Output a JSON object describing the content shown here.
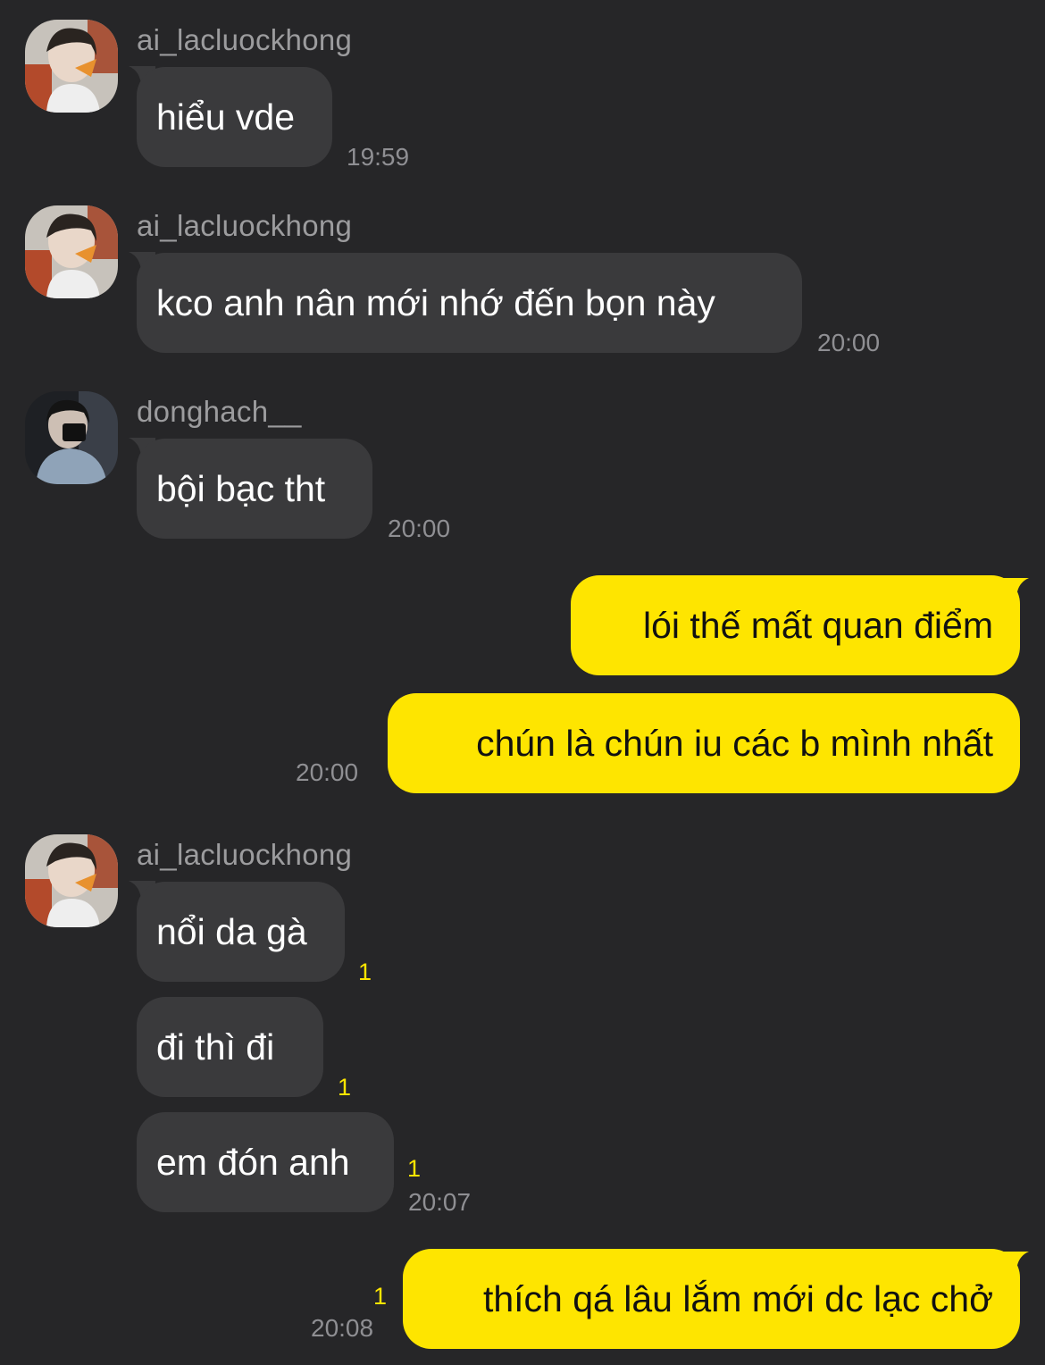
{
  "colors": {
    "background": "#262628",
    "incoming_bubble": "#3a3a3c",
    "outgoing_bubble": "#fee500",
    "unread": "#fee500",
    "meta_text": "#8f8f93"
  },
  "messages": [
    {
      "sender": "ai_lacluockhong",
      "text": "hiểu vde",
      "time": "19:59"
    },
    {
      "sender": "ai_lacluockhong",
      "text": "kco anh nân mới nhớ đến bọn này",
      "time": "20:00"
    },
    {
      "sender": "donghach__",
      "text": "bội bạc tht",
      "time": "20:00"
    },
    {
      "text": "lói thế mất quan điểm"
    },
    {
      "text": "chún là chún iu các b mình nhất",
      "time": "20:00"
    },
    {
      "sender": "ai_lacluockhong",
      "text": "nổi da gà",
      "unread": "1"
    },
    {
      "text": "đi thì đi",
      "unread": "1"
    },
    {
      "text": "em đón anh",
      "unread": "1",
      "time": "20:07"
    },
    {
      "text": "thích qá lâu lắm mới dc lạc chở",
      "unread": "1",
      "time": "20:08"
    }
  ]
}
